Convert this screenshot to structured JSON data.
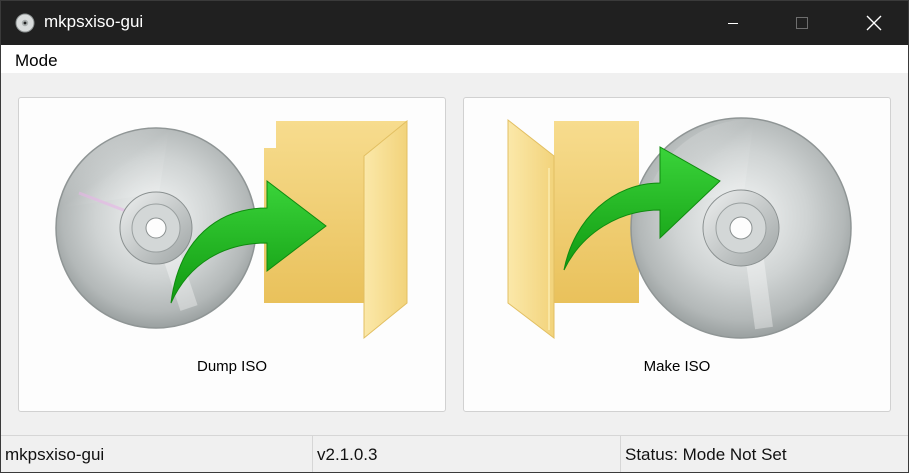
{
  "window": {
    "title": "mkpsxiso-gui",
    "icon": "disc-icon",
    "controls": [
      "minimize-icon",
      "maximize-icon",
      "close-icon"
    ]
  },
  "menubar": {
    "items": [
      {
        "label": "Mode"
      }
    ]
  },
  "main": {
    "buttons": [
      {
        "label": "Dump ISO",
        "icon": "disc-to-folder-icon"
      },
      {
        "label": "Make ISO",
        "icon": "folder-to-disc-icon"
      }
    ]
  },
  "statusbar": {
    "app_name": "mkpsxiso-gui",
    "version": "v2.1.0.3",
    "status": "Status: Mode Not Set"
  },
  "colors": {
    "titlebar": "#202020",
    "arrow_green": "#22b822",
    "folder_yellow": "#f3d27a"
  }
}
